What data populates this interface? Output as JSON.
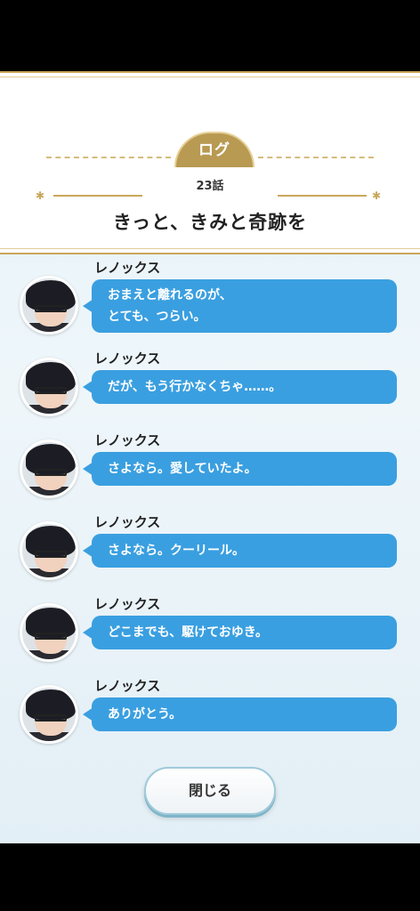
{
  "header": {
    "tab_label": "ログ",
    "episode": "23話",
    "chapter_title": "きっと、きみと奇跡を"
  },
  "entries": [
    {
      "speaker": "レノックス",
      "lines": [
        "おまえと離れるのが、",
        "とても、つらい。"
      ]
    },
    {
      "speaker": "レノックス",
      "lines": [
        "だが、もう行かなくちゃ……。"
      ]
    },
    {
      "speaker": "レノックス",
      "lines": [
        "さよなら。愛していたよ。"
      ]
    },
    {
      "speaker": "レノックス",
      "lines": [
        "さよなら。クーリール。"
      ]
    },
    {
      "speaker": "レノックス",
      "lines": [
        "どこまでも、駆けておゆき。"
      ]
    },
    {
      "speaker": "レノックス",
      "lines": [
        "ありがとう。"
      ]
    }
  ],
  "footer": {
    "close_label": "閉じる"
  },
  "colors": {
    "bubble": "#3a9fe0",
    "gold": "#c9a75a",
    "tab": "#b99a52"
  }
}
